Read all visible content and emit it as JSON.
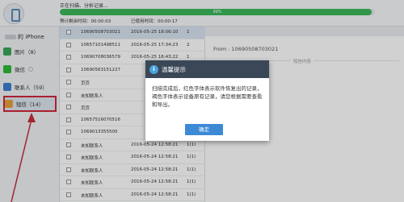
{
  "header": {
    "scan_status": "正在扫描、分析记录...",
    "progress_percent": 0.99,
    "progress_label": "99%",
    "time_est_label": "预计剩余时间：00:00:03",
    "time_used_label": "已使用时间：00:00:17"
  },
  "sidebar": {
    "device_label": "的 iPhone",
    "items": [
      {
        "label": "图片（8）",
        "color": "#3aa757",
        "active": false
      },
      {
        "label": "微信",
        "color": "#2dbb3a",
        "active": false
      },
      {
        "label": "联系人（59）",
        "color": "#3d7fd1",
        "active": false
      },
      {
        "label": "短信（14）",
        "color": "#e6a23c",
        "active": true
      }
    ]
  },
  "list": {
    "rows": [
      {
        "c1": "10690508703021",
        "c2": "2016-05-25 18:06:10",
        "c3": "1",
        "sel": true
      },
      {
        "c1": "10657101498511",
        "c2": "2016-05-25 17:34:23",
        "c3": "2",
        "sel": false
      },
      {
        "c1": "10690708036579",
        "c2": "2016-05-25 16:43:22",
        "c3": "1",
        "sel": false
      },
      {
        "c1": "10690563151227",
        "c2": "",
        "c3": "",
        "sel": false
      },
      {
        "c1": "页页",
        "c2": "",
        "c3": "",
        "sel": false
      },
      {
        "c1": "未知联系人",
        "c2": "",
        "c3": "",
        "sel": false
      },
      {
        "c1": "页页",
        "c2": "",
        "c3": "",
        "sel": false
      },
      {
        "c1": "10657516070516",
        "c2": "",
        "c3": "",
        "sel": false
      },
      {
        "c1": "1069013355500",
        "c2": "",
        "c3": "",
        "sel": false
      },
      {
        "c1": "未知联系人",
        "c2": "2016-05-24 12:58:21",
        "c3": "1(1)",
        "sel": false
      },
      {
        "c1": "未知联系人",
        "c2": "2016-05-24 12:58:21",
        "c3": "1(1)",
        "sel": false
      },
      {
        "c1": "未知联系人",
        "c2": "2016-05-24 12:58:21",
        "c3": "1(1)",
        "sel": false
      },
      {
        "c1": "未知联系人",
        "c2": "2016-05-24 12:58:21",
        "c3": "1(1)",
        "sel": false
      },
      {
        "c1": "未知联系人",
        "c2": "2016-05-24 12:58:21",
        "c3": "1(1)",
        "sel": false
      }
    ]
  },
  "detail": {
    "from_label": "From : 10690508703021",
    "content_label": "短信内容"
  },
  "modal": {
    "title": "温馨提示",
    "body": "扫描完成后，红色字体表示软件恢复出的记录，褐色字体表示设备原有记录，请您根据需要查看和导出。",
    "confirm_label": "确定"
  },
  "colors": {
    "progress": "#3bb85a",
    "modal_header": "#3a4757",
    "confirm": "#3c8ad6",
    "highlight": "#d0263a"
  }
}
